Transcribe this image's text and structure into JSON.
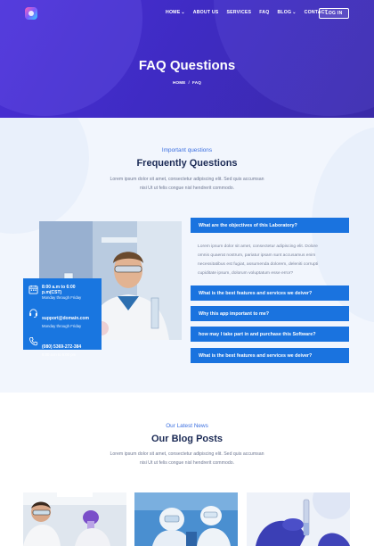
{
  "nav": {
    "items": [
      {
        "label": "HOME",
        "dropdown": true
      },
      {
        "label": "ABOUT US",
        "dropdown": false
      },
      {
        "label": "SERVICES",
        "dropdown": false
      },
      {
        "label": "FAQ",
        "dropdown": false
      },
      {
        "label": "BLOG",
        "dropdown": true
      },
      {
        "label": "CONTACT",
        "dropdown": false
      }
    ],
    "login_label": "LOG IN"
  },
  "hero": {
    "title": "FAQ Questions",
    "breadcrumb": {
      "home": "HOME",
      "separator": "/",
      "current": "FAQ"
    }
  },
  "faq_section": {
    "subtitle": "Important questions",
    "title": "Frequently Questions",
    "description_line1": "Lorem ipsum dolor sit amet, consectetur adipiscing elit. Sed quis accumsan",
    "description_line2": "nisi Ut ut felis congue nisl hendrerit commodo."
  },
  "contact_card": {
    "hours_title": "8:00 a.m to 6:00 p.m(CST)",
    "hours_sub": "Monday through Friday",
    "email_title": "support@domain.com",
    "email_sub": "Monday through Friday",
    "phone_title": "(080) 5369-272-384",
    "phone_sub": "8:00 a.m to 6:00 pm"
  },
  "accordion": {
    "items": [
      {
        "question": "What are the objectives of this Laboratory?"
      },
      {
        "question": "What is the best features and services we deiver?"
      },
      {
        "question": "Why this app important to me?"
      },
      {
        "question": "how may I take part in and purchase this Software?"
      },
      {
        "question": "What is the best features and services we deiver?"
      }
    ],
    "open_answer_lines": [
      "Lorem ipsum dolor sit amet, consectetur adipiscing elit. Dolore",
      "omnis quaerat nostrum, pariatur ipsam sunt accusamus enim",
      "necessitatibus est fugiat, assumenda dolorem, deleniti corrupti",
      "cupiditate ipsum, dolorum voluptatum esse error?"
    ]
  },
  "blog_section": {
    "subtitle": "Our Latest News",
    "title": "Our Blog Posts",
    "description_line1": "Lorem ipsum dolor sit amet, consectetur adipiscing elit. Sed quis accumsan",
    "description_line2": "nisi Ut ut felis congue nisl hendrerit commodo."
  },
  "colors": {
    "hero_gradient_start": "#4a2fd6",
    "hero_gradient_end": "#3a2aa8",
    "accent_blue": "#1a73df",
    "heading_navy": "#1b2a55",
    "subtitle_blue": "#3b6fe0",
    "section_bg": "#f2f6fd"
  },
  "icons": [
    "calendar-icon",
    "headset-icon",
    "phone-icon",
    "chevron-down-icon"
  ]
}
